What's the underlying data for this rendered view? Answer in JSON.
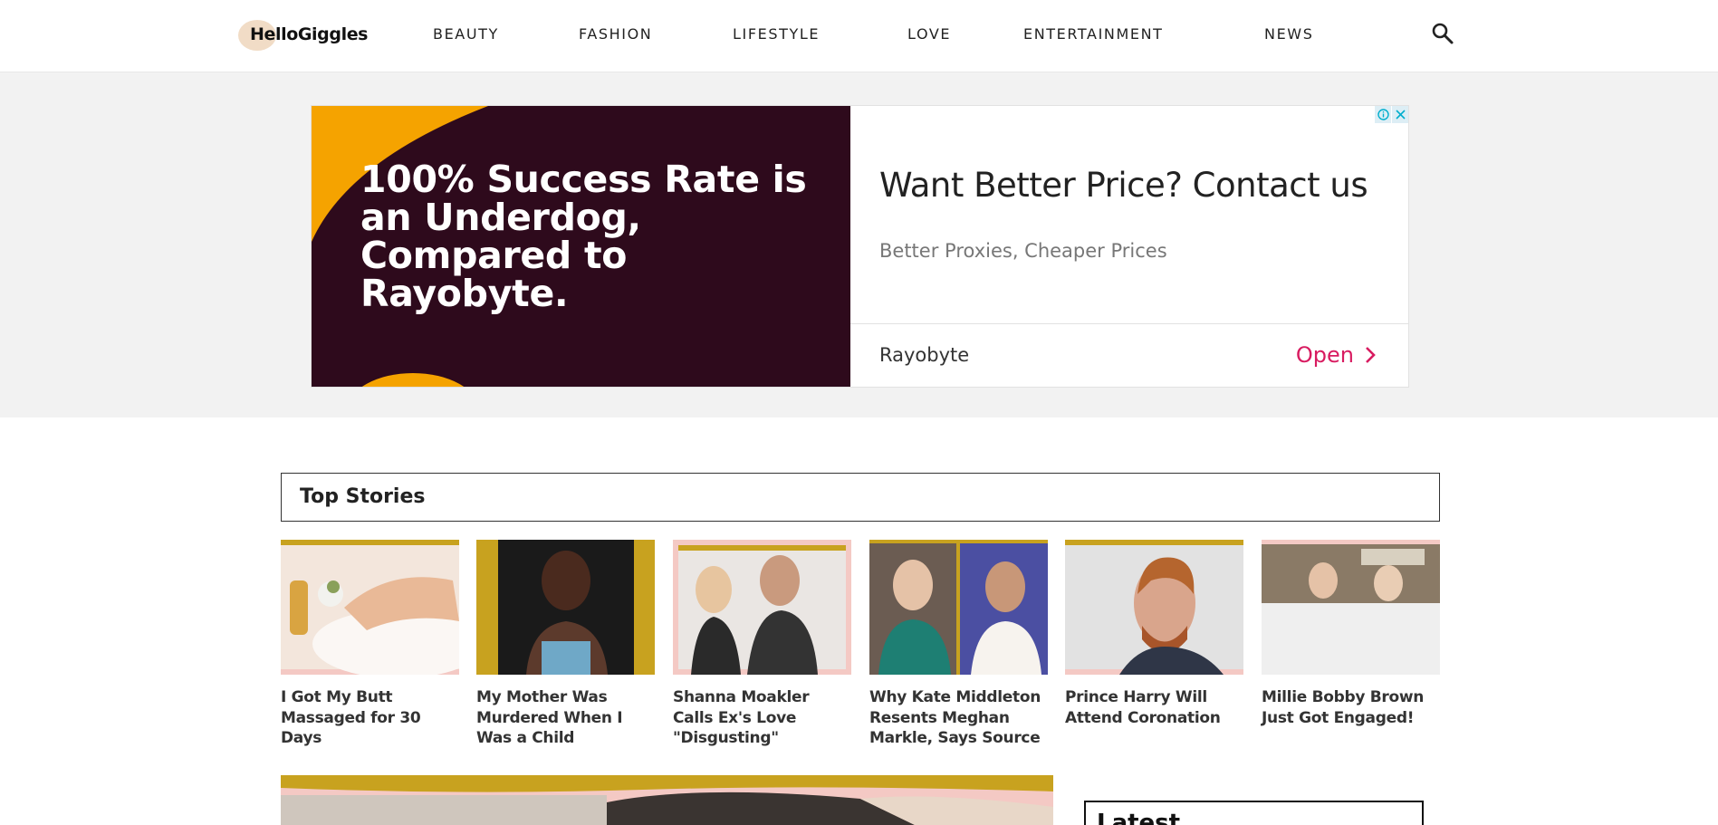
{
  "header": {
    "logo_text": "HelloGiggles",
    "nav": [
      "BEAUTY",
      "FASHION",
      "LIFESTYLE",
      "LOVE",
      "ENTERTAINMENT",
      "NEWS"
    ],
    "search_icon": "search-icon"
  },
  "ad": {
    "image_headline": "100% Success Rate is an Underdog, Compared to Rayobyte.",
    "title": "Want Better Price? Contact us",
    "subtitle": "Better Proxies, Cheaper Prices",
    "brand": "Rayobyte",
    "cta": "Open",
    "badge_icons": [
      "info-icon",
      "close-icon"
    ]
  },
  "top_stories": {
    "heading": "Top Stories",
    "items": [
      {
        "title": "I Got My Butt Massaged for 30 Days"
      },
      {
        "title": "My Mother Was Murdered When I Was a Child"
      },
      {
        "title": "Shanna Moakler Calls Ex's Love \"Disgusting\""
      },
      {
        "title": "Why Kate Middleton Resents Meghan Markle, Says Source"
      },
      {
        "title": "Prince Harry Will Attend Coronation"
      },
      {
        "title": "Millie Bobby Brown Just Got Engaged!"
      }
    ]
  },
  "sidebar": {
    "latest_heading": "Latest"
  },
  "colors": {
    "ad_bg": "#2e0a1c",
    "ad_accent": "#f5a300",
    "cta": "#d81b60",
    "thumb_gold": "#c8a21f",
    "thumb_pink": "#f4c9c4"
  }
}
